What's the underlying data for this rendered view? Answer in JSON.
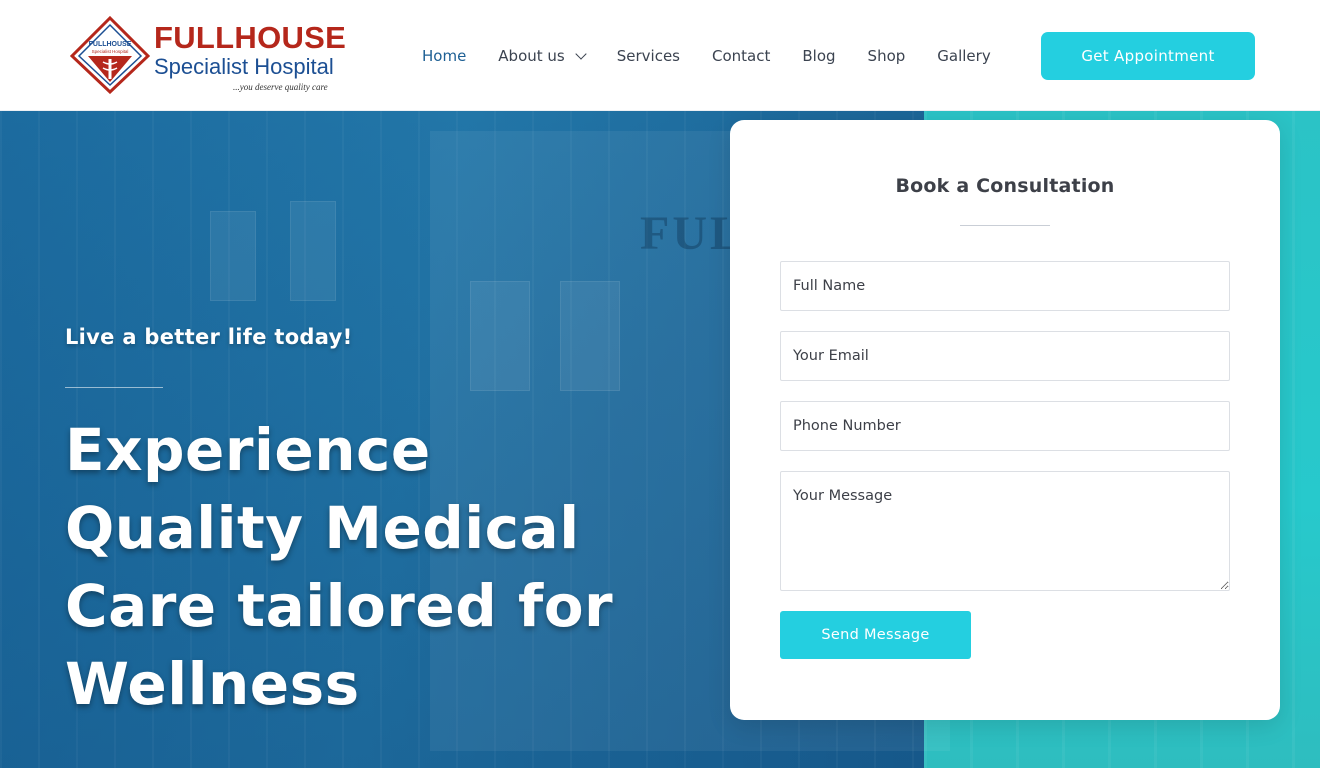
{
  "brand": {
    "name": "FULLHOUSE",
    "subtitle": "Specialist Hospital",
    "tagline": "...you deserve quality care",
    "mark_label": "FULLHOUSE",
    "mark_sub": "Specialist Hospital",
    "colors": {
      "red": "#b5271b",
      "blue": "#1c4f93"
    }
  },
  "nav": {
    "items": [
      {
        "label": "Home",
        "active": true
      },
      {
        "label": "About us",
        "has_dropdown": true
      },
      {
        "label": "Services"
      },
      {
        "label": "Contact"
      },
      {
        "label": "Blog"
      },
      {
        "label": "Shop"
      },
      {
        "label": "Gallery"
      }
    ],
    "cta_label": "Get Appointment"
  },
  "hero": {
    "kicker": "Live a better life today!",
    "headline": "Experience Quality Medical Care tailored for Wellness",
    "sign_text": "FUL"
  },
  "form": {
    "title": "Book a Consultation",
    "name_placeholder": "Full Name",
    "email_placeholder": "Your Email",
    "phone_placeholder": "Phone Number",
    "message_placeholder": "Your Message",
    "submit_label": "Send Message"
  },
  "colors": {
    "accent": "#24cfe0",
    "hero_blue": "#1c6b9f",
    "hero_teal": "#2bc3c6",
    "active_nav": "#1d5f94"
  }
}
